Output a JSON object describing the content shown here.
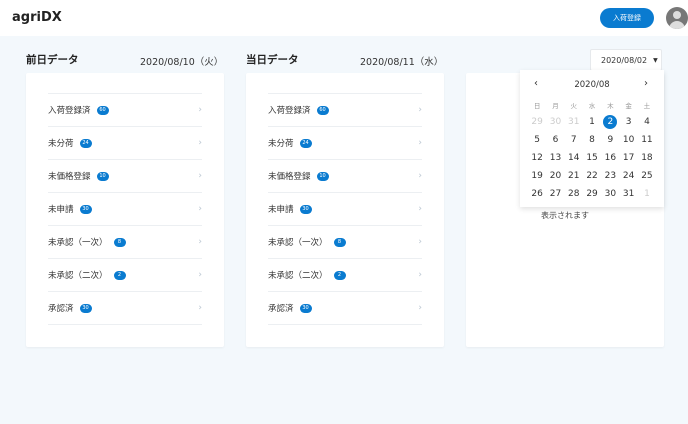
{
  "header": {
    "logo": "agriDX",
    "register_button": "入荷登録"
  },
  "previous": {
    "title": "前日データ",
    "date": "2020/08/10（火）",
    "items": [
      {
        "label": "入荷登録済",
        "count": "60"
      },
      {
        "label": "未分荷",
        "count": "24"
      },
      {
        "label": "未価格登録",
        "count": "10"
      },
      {
        "label": "未申請",
        "count": "30"
      },
      {
        "label": "未承認（一次）",
        "count": "8"
      },
      {
        "label": "未承認（二次）",
        "count": "2"
      },
      {
        "label": "承認済",
        "count": "30"
      }
    ]
  },
  "today": {
    "title": "当日データ",
    "date": "2020/08/11（水）",
    "items": [
      {
        "label": "入荷登録済",
        "count": "60"
      },
      {
        "label": "未分荷",
        "count": "24"
      },
      {
        "label": "未価格登録",
        "count": "10"
      },
      {
        "label": "未申請",
        "count": "30"
      },
      {
        "label": "未承認（一次）",
        "count": "8"
      },
      {
        "label": "未承認（二次）",
        "count": "2"
      },
      {
        "label": "承認済",
        "count": "30"
      }
    ]
  },
  "date_picker": {
    "value": "2020/08/02",
    "month": "2020/08",
    "selected": "2",
    "weekdays": [
      "日",
      "月",
      "火",
      "水",
      "木",
      "金",
      "土"
    ],
    "days": [
      "29",
      "30",
      "31",
      "1",
      "2",
      "3",
      "4",
      "5",
      "6",
      "7",
      "8",
      "9",
      "10",
      "11",
      "12",
      "13",
      "14",
      "15",
      "16",
      "17",
      "18",
      "19",
      "20",
      "21",
      "22",
      "23",
      "24",
      "25",
      "26",
      "27",
      "28",
      "29",
      "30",
      "31",
      "1"
    ],
    "muted_indexes": [
      0,
      1,
      2,
      34
    ]
  },
  "third_card": {
    "note": "表示されます"
  },
  "colors": {
    "accent": "#0a7bd0",
    "background": "#f3f8fc"
  }
}
